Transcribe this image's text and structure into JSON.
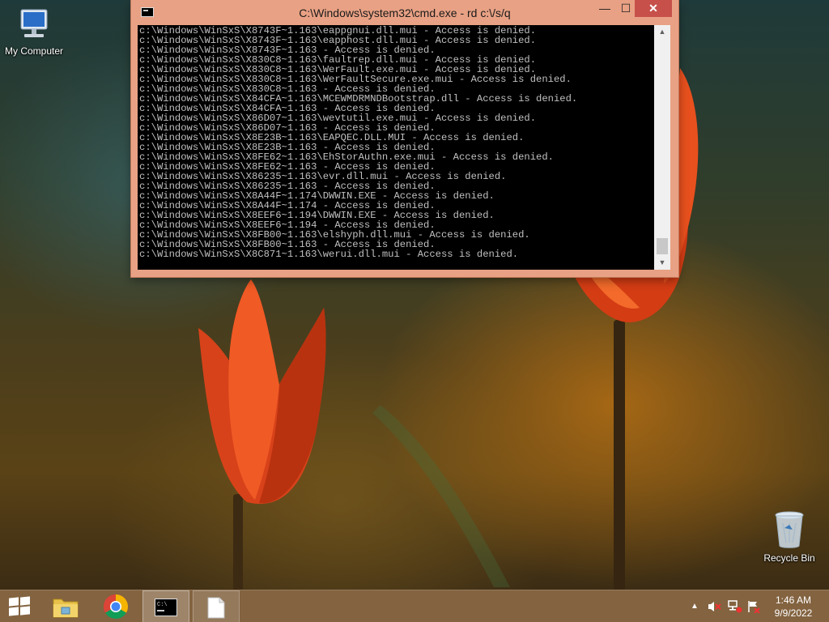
{
  "desktop": {
    "icons": [
      {
        "label": "My Computer",
        "icon": "computer-icon"
      },
      {
        "label": "Recycle Bin",
        "icon": "recycle-bin-icon"
      }
    ]
  },
  "cmd_window": {
    "title": "C:\\Windows\\system32\\cmd.exe - rd  c:\\/s/q",
    "buttons": {
      "minimize": "—",
      "maximize": "☐",
      "close": "✕"
    },
    "lines": [
      "c:\\Windows\\WinSxS\\X8743F~1.163\\eappgnui.dll.mui - Access is denied.",
      "c:\\Windows\\WinSxS\\X8743F~1.163\\eapphost.dll.mui - Access is denied.",
      "c:\\Windows\\WinSxS\\X8743F~1.163 - Access is denied.",
      "c:\\Windows\\WinSxS\\X830C8~1.163\\faultrep.dll.mui - Access is denied.",
      "c:\\Windows\\WinSxS\\X830C8~1.163\\WerFault.exe.mui - Access is denied.",
      "c:\\Windows\\WinSxS\\X830C8~1.163\\WerFaultSecure.exe.mui - Access is denied.",
      "c:\\Windows\\WinSxS\\X830C8~1.163 - Access is denied.",
      "c:\\Windows\\WinSxS\\X84CFA~1.163\\MCEWMDRMNDBootstrap.dll - Access is denied.",
      "c:\\Windows\\WinSxS\\X84CFA~1.163 - Access is denied.",
      "c:\\Windows\\WinSxS\\X86D07~1.163\\wevtutil.exe.mui - Access is denied.",
      "c:\\Windows\\WinSxS\\X86D07~1.163 - Access is denied.",
      "c:\\Windows\\WinSxS\\X8E23B~1.163\\EAPQEC.DLL.MUI - Access is denied.",
      "c:\\Windows\\WinSxS\\X8E23B~1.163 - Access is denied.",
      "c:\\Windows\\WinSxS\\X8FE62~1.163\\EhStorAuthn.exe.mui - Access is denied.",
      "c:\\Windows\\WinSxS\\X8FE62~1.163 - Access is denied.",
      "c:\\Windows\\WinSxS\\X86235~1.163\\evr.dll.mui - Access is denied.",
      "c:\\Windows\\WinSxS\\X86235~1.163 - Access is denied.",
      "c:\\Windows\\WinSxS\\X8A44F~1.174\\DWWIN.EXE - Access is denied.",
      "c:\\Windows\\WinSxS\\X8A44F~1.174 - Access is denied.",
      "c:\\Windows\\WinSxS\\X8EEF6~1.194\\DWWIN.EXE - Access is denied.",
      "c:\\Windows\\WinSxS\\X8EEF6~1.194 - Access is denied.",
      "c:\\Windows\\WinSxS\\X8FB00~1.163\\elshyph.dll.mui - Access is denied.",
      "c:\\Windows\\WinSxS\\X8FB00~1.163 - Access is denied.",
      "c:\\Windows\\WinSxS\\X8C871~1.163\\werui.dll.mui - Access is denied."
    ]
  },
  "taskbar": {
    "items": [
      {
        "name": "start-button",
        "icon": "windows-logo-icon"
      },
      {
        "name": "file-explorer",
        "icon": "folder-icon"
      },
      {
        "name": "chrome",
        "icon": "chrome-icon"
      },
      {
        "name": "command-prompt",
        "icon": "cmd-icon",
        "active": true
      },
      {
        "name": "document",
        "icon": "document-icon"
      }
    ],
    "clock": {
      "time": "1:46 AM",
      "date": "9/9/2022"
    }
  },
  "colors": {
    "titlebar": "#e8a184",
    "close_button": "#c7504b",
    "console_bg": "#000000",
    "console_text": "#c0c0c0",
    "taskbar": "#785630"
  }
}
